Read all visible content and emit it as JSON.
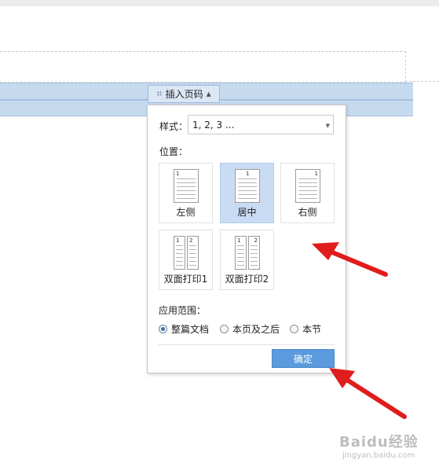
{
  "toolbar": {
    "insert_page_number_label": "插入页码"
  },
  "dialog": {
    "style_label": "样式：",
    "style_value": "1, 2, 3 ...",
    "position_label": "位置：",
    "positions": [
      {
        "label": "左侧",
        "selected": false
      },
      {
        "label": "居中",
        "selected": true
      },
      {
        "label": "右侧",
        "selected": false
      },
      {
        "label": "双面打印1",
        "selected": false
      },
      {
        "label": "双面打印2",
        "selected": false
      }
    ],
    "page_digit": "1",
    "page_digit_2": "2",
    "range_label": "应用范围：",
    "range_options": [
      {
        "label": "整篇文档",
        "checked": true
      },
      {
        "label": "本页及之后",
        "checked": false
      },
      {
        "label": "本节",
        "checked": false
      }
    ],
    "confirm_label": "确定"
  },
  "annotations": {
    "arrow_color": "#e01c1c"
  },
  "watermark": {
    "text": "Baidu经验",
    "sub": "jingyan.baidu.com"
  },
  "colors": {
    "accent": "#5b9bdd",
    "selected_bg": "#c9dcf4",
    "header_bar": "#c5d9ef"
  }
}
